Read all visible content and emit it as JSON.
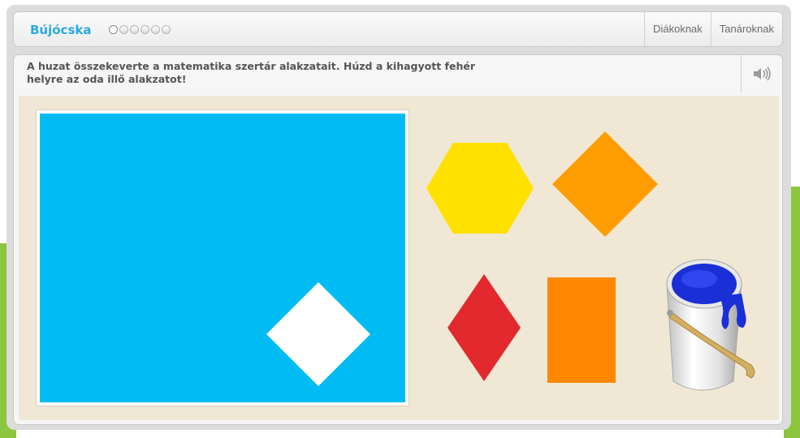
{
  "header": {
    "title": "Bújócska",
    "progress": {
      "total": 6,
      "current": 1
    },
    "nav": [
      {
        "label": "Diákoknak"
      },
      {
        "label": "Tanároknak"
      }
    ]
  },
  "task": {
    "instruction": "A huzat összekeverte a matematika szertár alakzatait. Húzd a kihagyott fehér helyre az oda illő alakzatot!",
    "sound_icon": "speaker-icon"
  },
  "colors": {
    "title": "#29a9e1",
    "board": "#00bcf2",
    "play_area": "#f0e8d5",
    "hole": "#ffffff",
    "hexagon": "#ffe100",
    "square_orange": "#ff9d00",
    "rhombus_red": "#e2292e",
    "rectangle_orange": "#ff8800",
    "paint_blue": "#1a2fd6",
    "background_green": "#8cc63f"
  },
  "shapes": [
    {
      "name": "yellow-hexagon",
      "type": "hexagon"
    },
    {
      "name": "orange-diamond",
      "type": "square-rotated"
    },
    {
      "name": "red-rhombus",
      "type": "rhombus"
    },
    {
      "name": "orange-rectangle",
      "type": "rectangle"
    }
  ]
}
